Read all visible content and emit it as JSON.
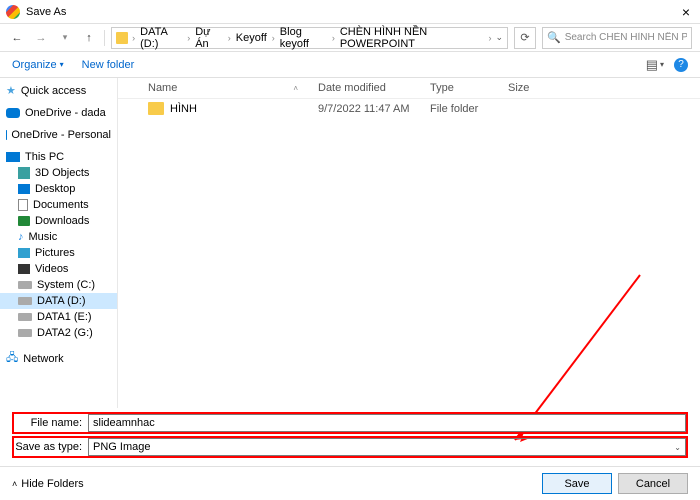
{
  "title": "Save As",
  "breadcrumbs": [
    "DATA  (D:)",
    "Dự Án",
    "Keyoff",
    "Blog keyoff",
    "CHÈN HÌNH NỀN POWERPOINT"
  ],
  "search_placeholder": "Search CHÈN HÌNH NỀN PO...",
  "toolbar": {
    "organize": "Organize",
    "new_folder": "New folder"
  },
  "columns": {
    "name": "Name",
    "date": "Date modified",
    "type": "Type",
    "size": "Size"
  },
  "rows": [
    {
      "name": "HÌNH",
      "date": "9/7/2022 11:47 AM",
      "type": "File folder",
      "size": ""
    }
  ],
  "sidebar": {
    "quick": "Quick access",
    "od1": "OneDrive - dada",
    "od2": "OneDrive - Personal",
    "thispc": "This PC",
    "items": [
      "3D Objects",
      "Desktop",
      "Documents",
      "Downloads",
      "Music",
      "Pictures",
      "Videos",
      "System (C:)",
      "DATA  (D:)",
      "DATA1 (E:)",
      "DATA2 (G:)"
    ],
    "network": "Network"
  },
  "form": {
    "filename_label": "File name:",
    "filename_value": "slideamnhac",
    "type_label": "Save as type:",
    "type_value": "PNG Image"
  },
  "footer": {
    "hide": "Hide Folders",
    "save": "Save",
    "cancel": "Cancel"
  }
}
